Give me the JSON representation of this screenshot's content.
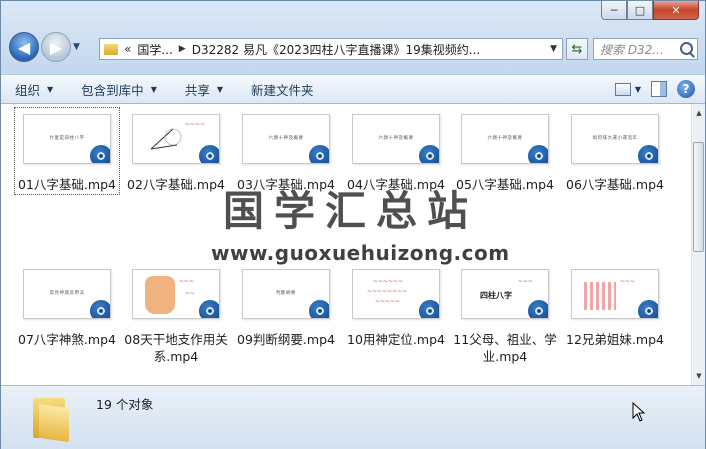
{
  "window": {
    "caption_minimize": "─",
    "caption_maximize": "□",
    "caption_close": "✕"
  },
  "address": {
    "chevrons": "«",
    "crumbs": [
      "国学...",
      "D32282 易凡《2023四柱八字直播课》19集视频约..."
    ]
  },
  "search": {
    "placeholder": "搜索 D32..."
  },
  "toolbar": {
    "organize": "组织",
    "include_in_library": "包含到库中",
    "share": "共享",
    "new_folder": "新建文件夹"
  },
  "files": [
    {
      "name": "01八字基础.mp4",
      "thumb": "什麼是四柱八字"
    },
    {
      "name": "02八字基础.mp4",
      "thumb": ""
    },
    {
      "name": "03八字基础.mp4",
      "thumb": "六親十神及概要"
    },
    {
      "name": "04八字基础.mp4",
      "thumb": "六親十神及概要"
    },
    {
      "name": "05八字基础.mp4",
      "thumb": "六親十神及概要"
    },
    {
      "name": "06八字基础.mp4",
      "thumb": "如何排大運小運流年"
    },
    {
      "name": "07八字神煞.mp4",
      "thumb": "常見神煞及用法"
    },
    {
      "name": "08天干地支作用关系.mp4",
      "thumb": ""
    },
    {
      "name": "09判断纲要.mp4",
      "thumb": "判斷綱要"
    },
    {
      "name": "10用神定位.mp4",
      "thumb": ""
    },
    {
      "name": "11父母、祖业、学业.mp4",
      "thumb": "四柱八字"
    },
    {
      "name": "12兄弟姐妹.mp4",
      "thumb": ""
    }
  ],
  "watermark": {
    "cn": "国学汇总站",
    "en": "www.guoxuehuizong.com"
  },
  "status": {
    "count_text": "19 个对象"
  },
  "colors": {
    "badge": "#0b3f86",
    "accent": "#2a63b8"
  }
}
